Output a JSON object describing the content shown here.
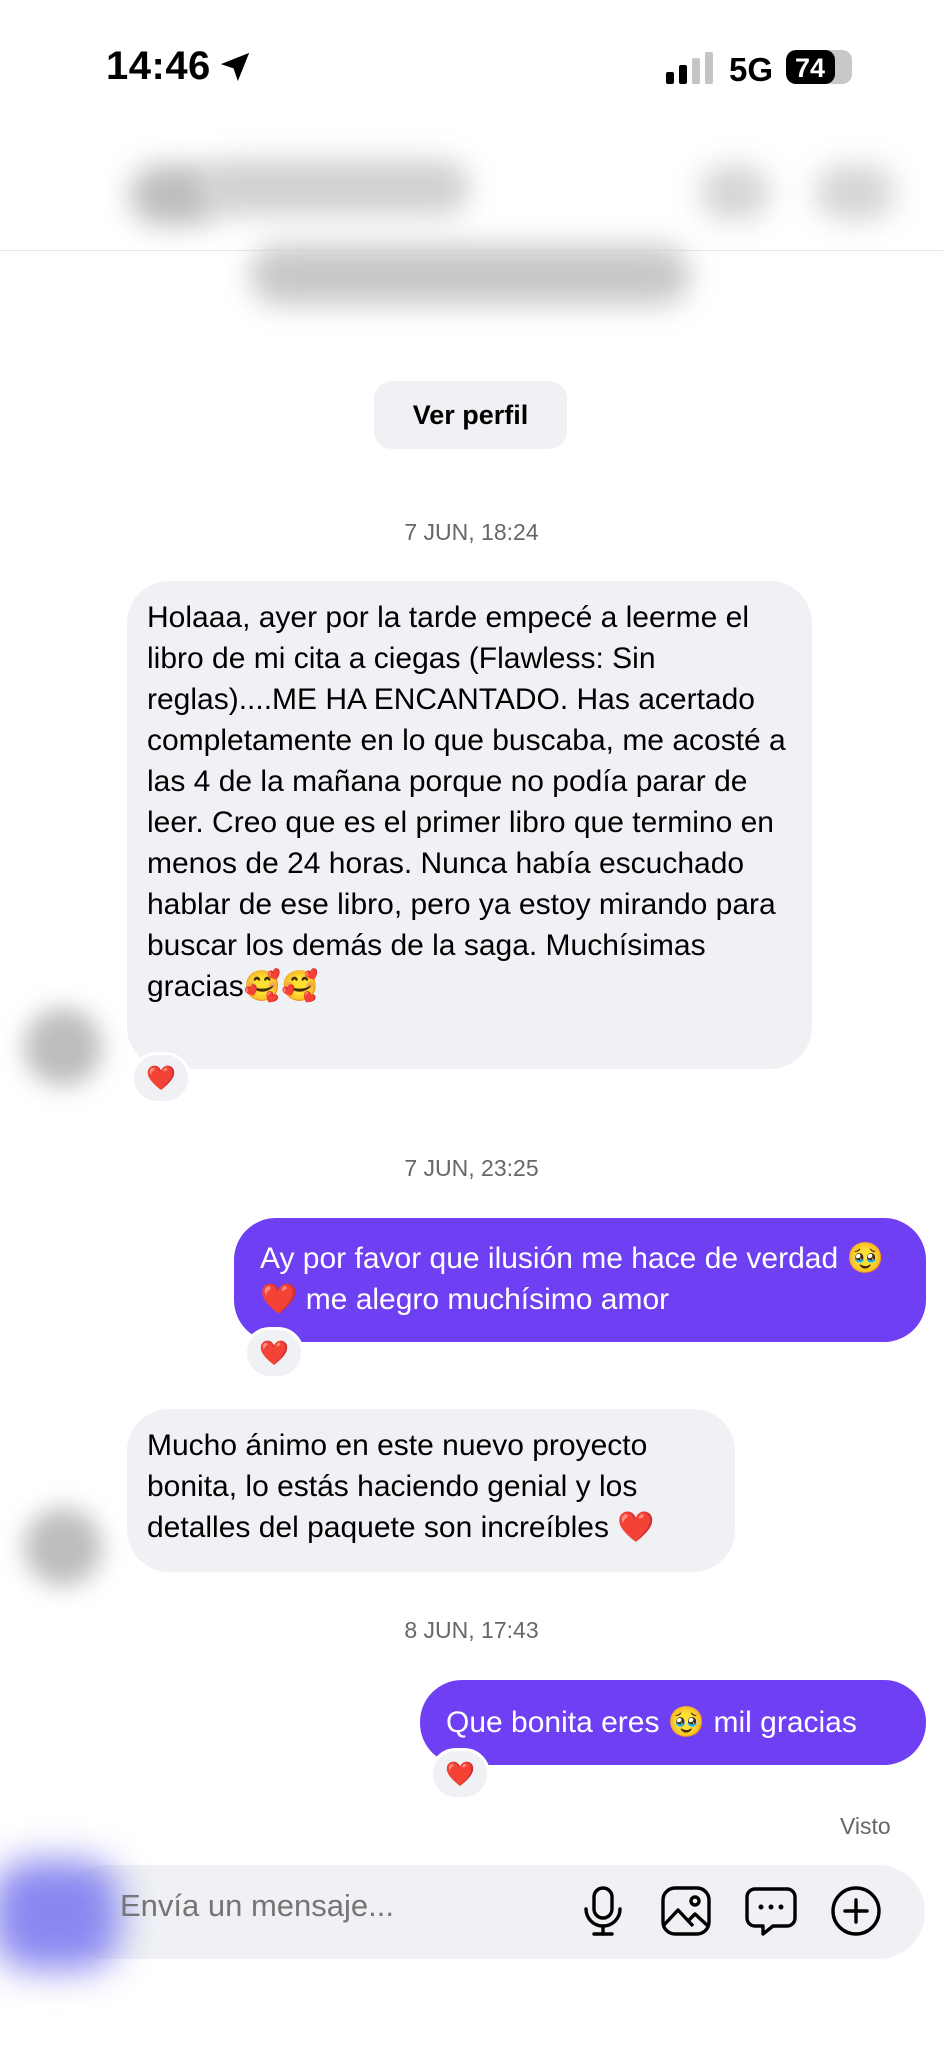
{
  "status_bar": {
    "time": "14:46",
    "network": "5G",
    "battery": "74",
    "battery_level": 0.74,
    "icons": [
      "location-arrow-icon",
      "signal-bars-icon"
    ]
  },
  "profile": {
    "view_profile_label": "Ver perfil"
  },
  "messages": [
    {
      "type": "date",
      "text": "7 JUN, 18:24"
    },
    {
      "type": "incoming",
      "text": "Holaaa, ayer por la tarde empecé a leerme el libro de mi cita a ciegas (Flawless: Sin reglas)....ME HA ENCANTADO. Has acertado completamente en lo que buscaba, me acosté a las 4 de la mañana porque no podía parar de leer. Creo que es el primer libro que termino en menos de 24 horas. Nunca había escuchado hablar de ese libro, pero ya estoy mirando para buscar los demás de la saga. Muchísimas gracias🥰🥰",
      "reaction": "❤️"
    },
    {
      "type": "date",
      "text": "7 JUN, 23:25"
    },
    {
      "type": "outgoing",
      "text": "Ay por favor que ilusión me hace de verdad 🥹❤️ me alegro muchísimo amor",
      "reaction": "❤️"
    },
    {
      "type": "incoming",
      "text": "Mucho ánimo en este nuevo proyecto bonita, lo estás haciendo genial y los detalles del paquete son increíbles ❤️"
    },
    {
      "type": "date",
      "text": "8 JUN, 17:43"
    },
    {
      "type": "outgoing",
      "text": "Que bonita eres 🥹 mil gracias",
      "reaction": "❤️"
    }
  ],
  "seen_label": "Visto",
  "composer": {
    "placeholder": "Envía un mensaje...",
    "icons": [
      "microphone-icon",
      "image-icon",
      "sticker-chat-icon",
      "plus-circle-icon"
    ]
  },
  "colors": {
    "outgoing_bubble": "#6e3ff3",
    "incoming_bubble": "#eff1f4",
    "reaction_heart": "#e02424"
  }
}
